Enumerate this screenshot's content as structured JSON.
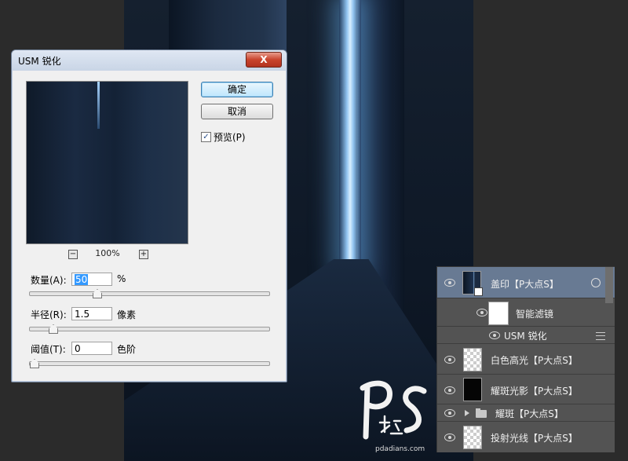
{
  "dialog": {
    "title": "USM 锐化",
    "close_label": "X",
    "ok_label": "确定",
    "cancel_label": "取消",
    "preview_label": "预览(P)",
    "preview_checked": true,
    "zoom_level": "100%",
    "zoom_out_label": "−",
    "zoom_in_label": "+",
    "amount": {
      "label": "数量(A):",
      "value": "50",
      "unit": "%",
      "slider_fraction": 0.27
    },
    "radius": {
      "label": "半径(R):",
      "value": "1.5",
      "unit": "像素",
      "slider_fraction": 0.08
    },
    "threshold": {
      "label": "阈值(T):",
      "value": "0",
      "unit": "色阶",
      "slider_fraction": 0.0
    }
  },
  "layers": {
    "items": [
      {
        "name": "盖印【P大点S】",
        "selected": true,
        "thumb": "photo"
      },
      {
        "name": "智能滤镜",
        "sub": true
      },
      {
        "name": "USM 锐化",
        "sub": true
      },
      {
        "name": "白色高光【P大点S】",
        "thumb": "checker"
      },
      {
        "name": "耀斑光影【P大点S】",
        "thumb": "dark"
      },
      {
        "name": "耀斑【P大点S】",
        "group": true
      },
      {
        "name": "投射光线【P大点S】",
        "thumb": "checker"
      }
    ]
  },
  "watermark": {
    "logo_text": "P大点S",
    "site": "pdadians.com"
  },
  "colors": {
    "selected_layer": "#687a93",
    "panel_bg": "#535353",
    "door_glow": "#d9efff"
  }
}
